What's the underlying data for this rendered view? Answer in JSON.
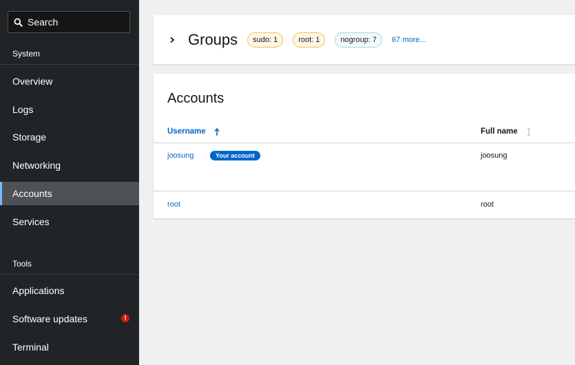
{
  "sidebar": {
    "search_label": "Search",
    "section_system": "System",
    "section_tools": "Tools",
    "items": [
      {
        "label": "Overview"
      },
      {
        "label": "Logs"
      },
      {
        "label": "Storage"
      },
      {
        "label": "Networking"
      },
      {
        "label": "Accounts",
        "active": true
      },
      {
        "label": "Services"
      },
      {
        "label": "Applications"
      },
      {
        "label": "Software updates",
        "alert": "!"
      },
      {
        "label": "Terminal"
      }
    ]
  },
  "groups": {
    "title": "Groups",
    "chips": [
      {
        "label": "sudo: 1"
      },
      {
        "label": "root: 1"
      },
      {
        "label": "nogroup: 7"
      }
    ],
    "more": "67 more..."
  },
  "accounts": {
    "title": "Accounts",
    "columns": {
      "username": "Username",
      "fullname": "Full name"
    },
    "rows": [
      {
        "username": "joosung",
        "badge": "Your account",
        "fullname": "joosung"
      },
      {
        "username": "root",
        "fullname": "root"
      }
    ]
  },
  "colors": {
    "sidebar_bg": "#212427",
    "link": "#0066cc",
    "alert": "#c9190b",
    "active_border": "#73bcf7"
  }
}
